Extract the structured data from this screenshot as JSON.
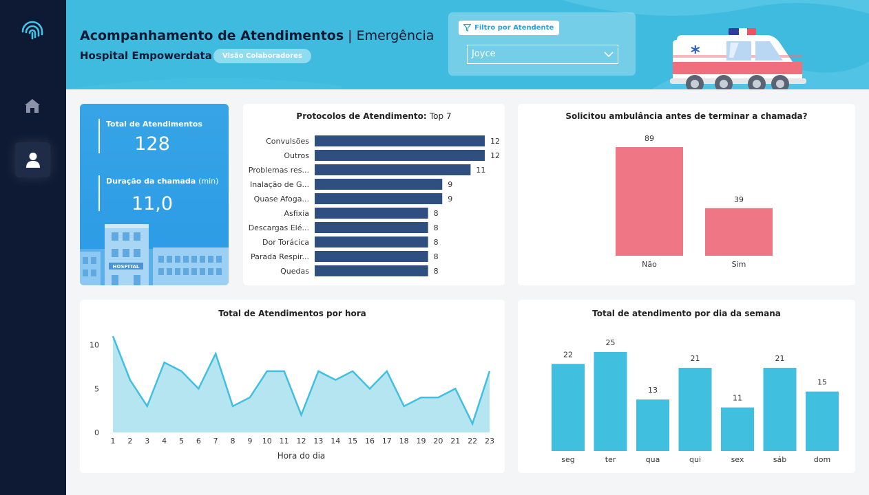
{
  "header": {
    "title": "Acompanhamento de Atendimentos",
    "separator": "|",
    "subtitle": "Emergência",
    "hospital": "Hospital Empowerdata",
    "view_badge": "Visão Colaboradores"
  },
  "filter": {
    "label": "Filtro por Atendente",
    "selected": "Joyce"
  },
  "kpis": {
    "total_label": "Total de Atendimentos",
    "total_value": "128",
    "duration_label": "Duração da chamada",
    "duration_unit": "(min)",
    "duration_value": "11,0",
    "building_sign": "HOSPITAL"
  },
  "colors": {
    "sidebar": "#0e1a33",
    "header": "#3fbbe0",
    "bar_navy": "#2e4f7f",
    "bar_pink": "#ef7685",
    "bar_cyan": "#41bfdf",
    "area_fill": "#b5e5f1",
    "kpi_blue": "#2b9ae6"
  },
  "icons": {
    "logo": "fingerprint-logo-icon",
    "home": "home-icon",
    "user": "user-icon",
    "filter": "filter-icon",
    "chevron": "chevron-down-icon"
  },
  "chart_data": [
    {
      "type": "bar",
      "orientation": "horizontal",
      "title": "Protocolos de Atendimento:",
      "title_suffix": "Top 7",
      "categories": [
        "Convulsões",
        "Outros",
        "Problemas res...",
        "Inalação de G...",
        "Quase Afoga...",
        "Asfixia",
        "Descargas Elé...",
        "Dor Torácica",
        "Parada Respir...",
        "Quedas"
      ],
      "values": [
        12,
        12,
        11,
        9,
        9,
        8,
        8,
        8,
        8,
        8
      ],
      "xlim": [
        0,
        12
      ]
    },
    {
      "type": "bar",
      "title": "Solicitou ambulância antes de terminar a chamada?",
      "categories": [
        "Não",
        "Sim"
      ],
      "values": [
        89,
        39
      ],
      "ylim": [
        0,
        89
      ]
    },
    {
      "type": "area",
      "title": "Total de Atendimentos por hora",
      "xlabel": "Hora do dia",
      "x": [
        1,
        2,
        3,
        4,
        5,
        6,
        7,
        8,
        9,
        10,
        11,
        12,
        13,
        14,
        15,
        16,
        17,
        18,
        19,
        20,
        21,
        22,
        23
      ],
      "values": [
        11,
        6,
        3,
        8,
        7,
        5,
        9,
        3,
        4,
        7,
        7,
        2,
        7,
        6,
        7,
        5,
        7,
        3,
        4,
        4,
        5,
        1,
        7
      ],
      "yticks": [
        0,
        5,
        10
      ],
      "ylim": [
        0,
        11
      ]
    },
    {
      "type": "bar",
      "title": "Total de atendimento por dia da semana",
      "categories": [
        "seg",
        "ter",
        "qua",
        "qui",
        "sex",
        "sáb",
        "dom"
      ],
      "values": [
        22,
        25,
        13,
        21,
        11,
        21,
        15
      ],
      "ylim": [
        0,
        25
      ]
    }
  ]
}
